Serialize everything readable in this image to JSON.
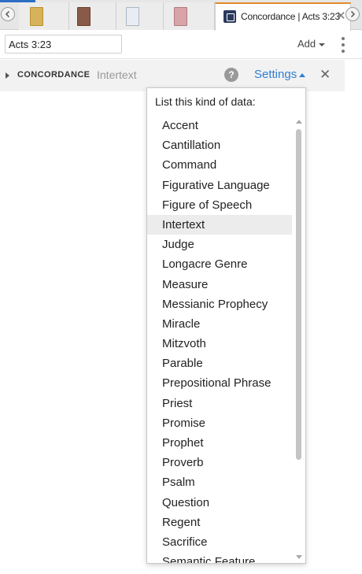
{
  "tabs": {
    "active_title": "Concordance | Acts 3:23"
  },
  "address": {
    "reference_value": "Acts 3:23",
    "add_label": "Add"
  },
  "panel": {
    "title": "CONCORDANCE",
    "subtitle": "Intertext",
    "help_label": "?",
    "settings_label": "Settings"
  },
  "dropdown": {
    "heading": "List this kind of data:",
    "selected": "Intertext",
    "items": [
      "Accent",
      "Cantillation",
      "Command",
      "Figurative Language",
      "Figure of Speech",
      "Intertext",
      "Judge",
      "Longacre Genre",
      "Measure",
      "Messianic Prophecy",
      "Miracle",
      "Mitzvoth",
      "Parable",
      "Prepositional Phrase",
      "Priest",
      "Promise",
      "Prophet",
      "Proverb",
      "Psalm",
      "Question",
      "Regent",
      "Sacrifice",
      "Semantic Feature"
    ]
  },
  "colors": {
    "accent_blue": "#2e7fd1",
    "active_tab_border": "#e08a2c",
    "selected_row": "#ececec"
  }
}
